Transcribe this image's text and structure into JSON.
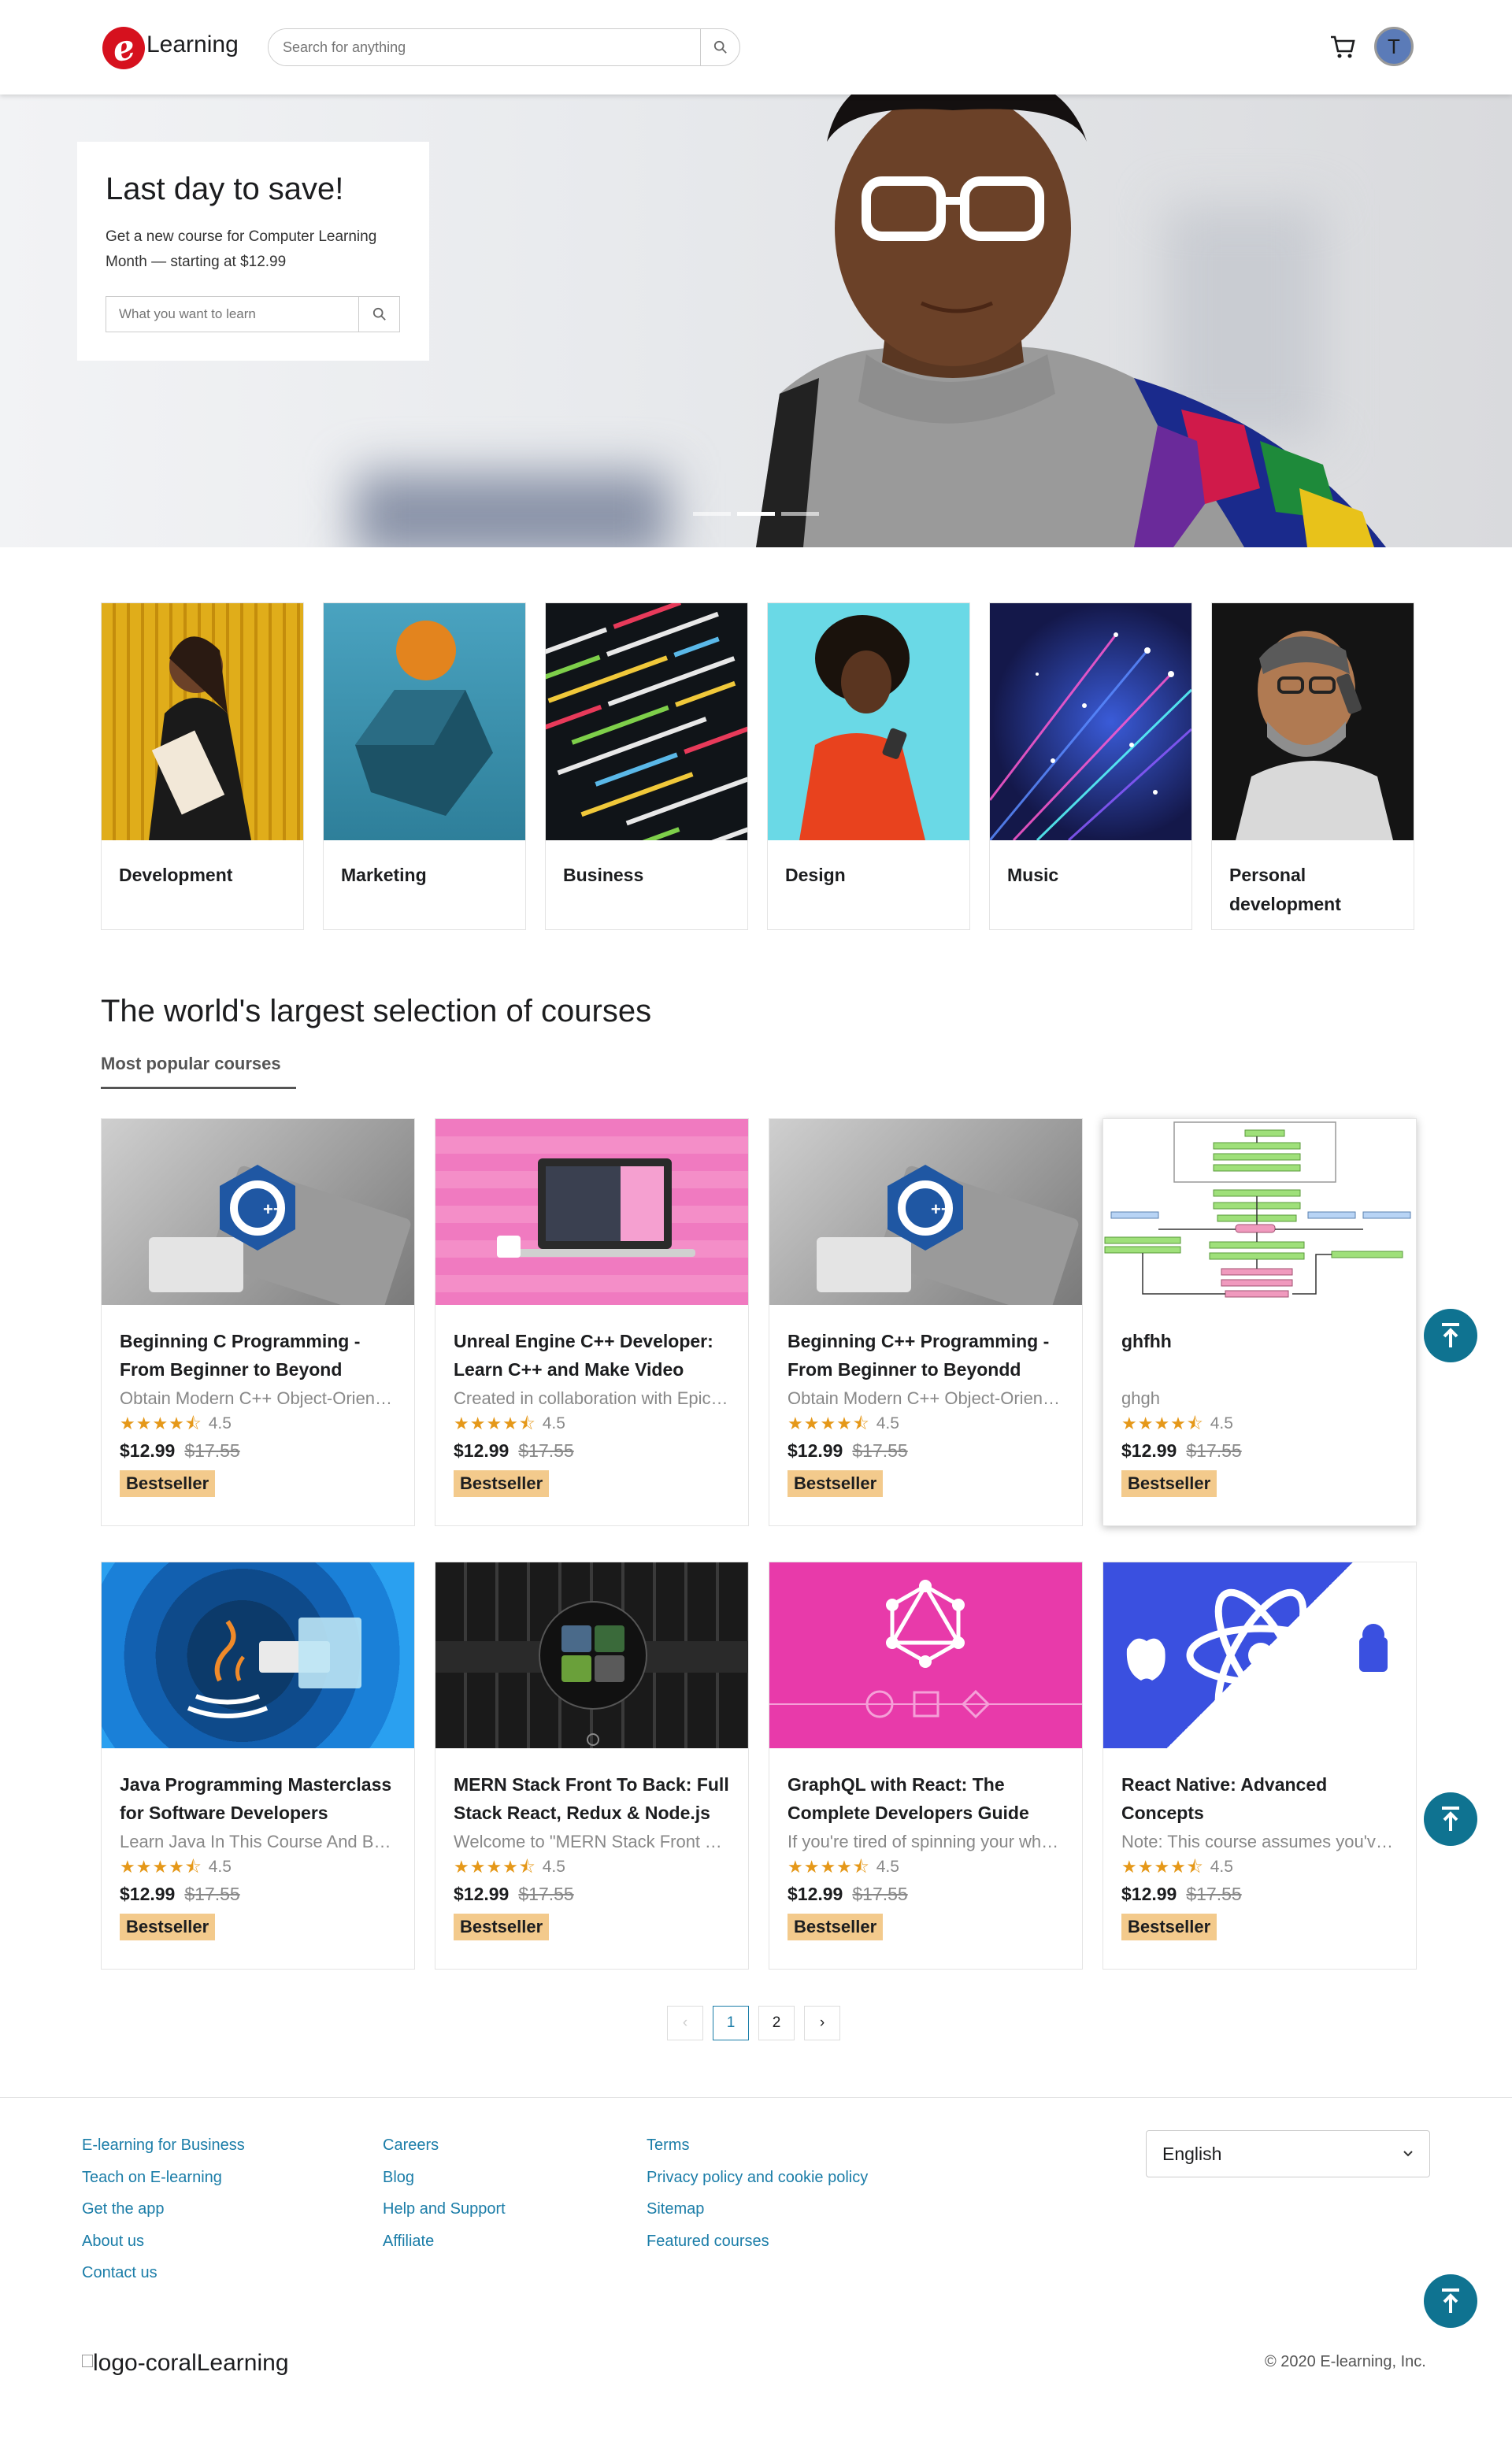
{
  "nav": {
    "logo_letter": "e",
    "logo_text": "Learning",
    "search_placeholder": "Search for anything",
    "avatar_initial": "T"
  },
  "hero": {
    "title": "Last day to save!",
    "subtitle": "Get a new course for Computer Learning Month — starting at $12.99",
    "search_placeholder": "What you want to learn"
  },
  "categories": [
    "Development",
    "Marketing",
    "Business",
    "Design",
    "Music",
    "Personal development"
  ],
  "section": {
    "title": "The world's largest selection of courses",
    "tab": "Most popular courses"
  },
  "courses": [
    {
      "title": "Beginning C Programming - From Beginner to Beyond",
      "desc": "Obtain Modern C++ Object-Oriented Programming",
      "stars": "★★★★⯪",
      "rating": "4.5",
      "price": "$12.99",
      "old_price": "$17.55",
      "badge": "Bestseller"
    },
    {
      "title": "Unreal Engine C++ Developer: Learn C++ and Make Video Games",
      "desc": "Created in collaboration with Epic Games",
      "stars": "★★★★⯪",
      "rating": "4.5",
      "price": "$12.99",
      "old_price": "$17.55",
      "badge": "Bestseller"
    },
    {
      "title": "Beginning C++ Programming - From Beginner to Beyondd",
      "desc": "Obtain Modern C++ Object-Oriented Programming",
      "stars": "★★★★⯪",
      "rating": "4.5",
      "price": "$12.99",
      "old_price": "$17.55",
      "badge": "Bestseller"
    },
    {
      "title": "ghfhh",
      "desc": "ghgh",
      "stars": "★★★★⯪",
      "rating": "4.5",
      "price": "$12.99",
      "old_price": "$17.55",
      "badge": "Bestseller"
    },
    {
      "title": "Java Programming Masterclass for Software Developers",
      "desc": "Learn Java In This Course And Become a Computer Programmer",
      "stars": "★★★★⯪",
      "rating": "4.5",
      "price": "$12.99",
      "old_price": "$17.55",
      "badge": "Bestseller"
    },
    {
      "title": "MERN Stack Front To Back: Full Stack React, Redux & Node.js",
      "desc": "Welcome to \"MERN Stack Front To Back\"",
      "stars": "★★★★⯪",
      "rating": "4.5",
      "price": "$12.99",
      "old_price": "$17.55",
      "badge": "Bestseller"
    },
    {
      "title": "GraphQL with React: The Complete Developers Guide",
      "desc": "If you're tired of spinning your wheels",
      "stars": "★★★★⯪",
      "rating": "4.5",
      "price": "$12.99",
      "old_price": "$17.55",
      "badge": "Bestseller"
    },
    {
      "title": "React Native: Advanced Concepts",
      "desc": "Note: This course assumes you've used React Native",
      "stars": "★★★★⯪",
      "rating": "4.5",
      "price": "$12.99",
      "old_price": "$17.55",
      "badge": "Bestseller"
    }
  ],
  "pagination": {
    "prev": "‹",
    "pages": [
      "1",
      "2"
    ],
    "next": "›"
  },
  "footer": {
    "col1": [
      "E-learning for Business",
      "Teach on E-learning",
      "Get the app",
      "About us",
      "Contact us"
    ],
    "col2": [
      "Careers",
      "Blog",
      "Help and Support",
      "Affiliate"
    ],
    "col3": [
      "Terms",
      "Privacy policy and cookie policy",
      "Sitemap",
      "Featured courses"
    ],
    "language": "English",
    "logo_alt": "logo-coral",
    "logo_text": "Learning",
    "copyright": "© 2020 E-learning, Inc."
  },
  "icons": {
    "search": "search-icon",
    "cart": "cart-icon",
    "scroll_top": "arrow-up-to-line-icon"
  },
  "colors": {
    "brand_red": "#d6111e",
    "link_blue": "#1b7da8",
    "star_orange": "#e59819",
    "badge": "#f3ca8c",
    "scroll_button": "#0f7391"
  }
}
